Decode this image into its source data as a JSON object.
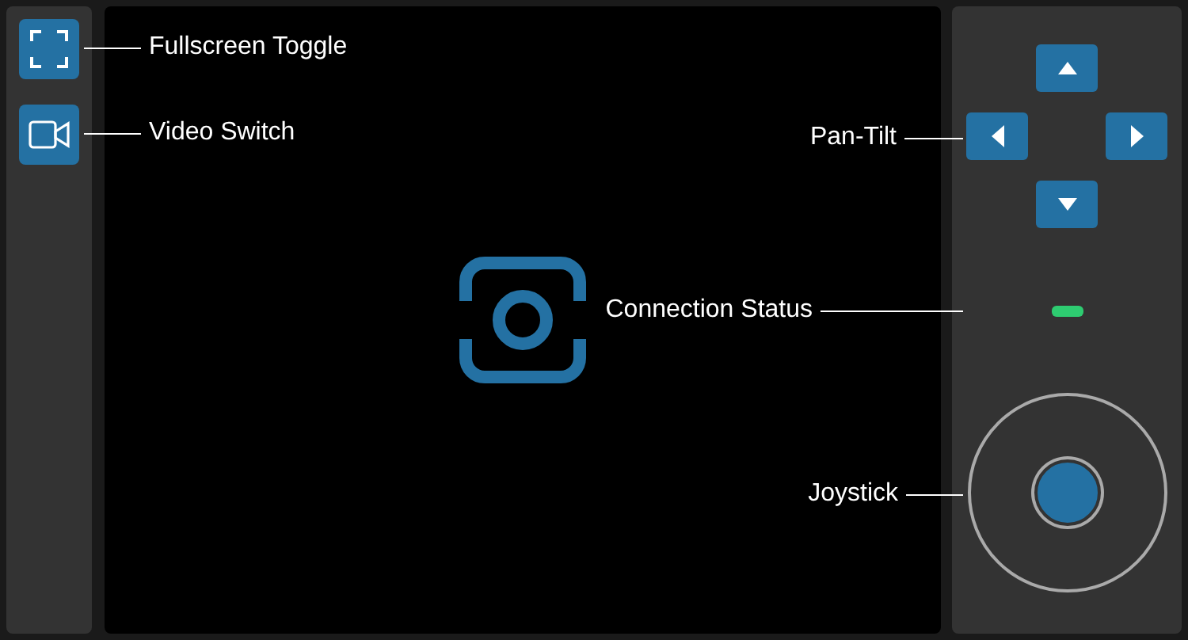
{
  "sidebar": {
    "buttons": [
      {
        "kind": "fullscreen",
        "annotation": "Fullscreen Toggle"
      },
      {
        "kind": "video",
        "annotation": "Video Switch"
      }
    ]
  },
  "video": {
    "kind": "placeholder"
  },
  "pan_tilt": {
    "annotation": "Pan-Tilt",
    "buttons": [
      {
        "kind": "up"
      },
      {
        "kind": "left"
      },
      {
        "kind": "right"
      },
      {
        "kind": "down"
      }
    ]
  },
  "connection_status": {
    "connected": true,
    "annotation": "Connection Status"
  },
  "joystick": {
    "annotation": "Joystick"
  }
}
